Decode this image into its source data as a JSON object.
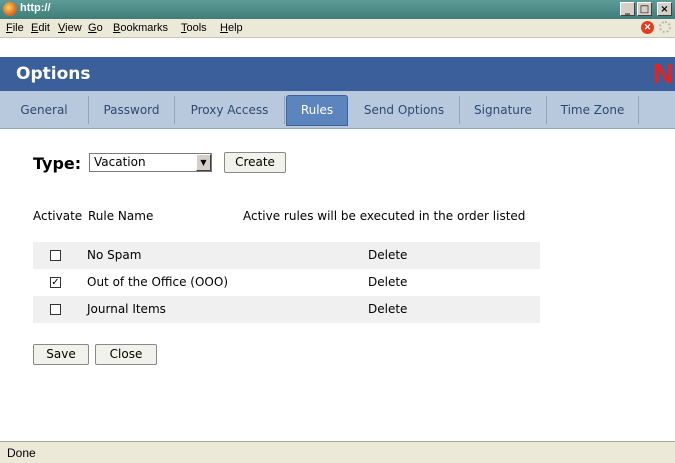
{
  "window": {
    "title": "http://",
    "buttons": {
      "minimize": "_",
      "maximize": "□",
      "close": "×"
    }
  },
  "menu": [
    "File",
    "Edit",
    "View",
    "Go",
    "Bookmarks",
    "Tools",
    "Help"
  ],
  "header": {
    "title": "Options",
    "logo": "N",
    "logo_color": "#e8231d"
  },
  "tabs": [
    {
      "label": "General"
    },
    {
      "label": "Password"
    },
    {
      "label": "Proxy Access"
    },
    {
      "label": "Rules",
      "active": true
    },
    {
      "label": "Send Options"
    },
    {
      "label": "Signature"
    },
    {
      "label": "Time Zone"
    }
  ],
  "type_section": {
    "label": "Type:",
    "selected": "Vacation",
    "create_label": "Create"
  },
  "rules_table": {
    "col_activate": "Activate",
    "col_name": "Rule Name",
    "note": "Active rules will be executed in the order listed",
    "rows": [
      {
        "name": "No Spam",
        "checked": false,
        "delete_label": "Delete"
      },
      {
        "name": "Out of the Office (OOO)",
        "checked": true,
        "delete_label": "Delete"
      },
      {
        "name": "Journal Items",
        "checked": false,
        "delete_label": "Delete"
      }
    ]
  },
  "actions": {
    "save_label": "Save",
    "close_label": "Close"
  },
  "status": {
    "text": "Done"
  },
  "colors": {
    "titlebar": "#4f8d87",
    "header_bg": "#3b5f9b",
    "tab_bg": "#b8c9dd",
    "tab_active": "#5d85bd"
  }
}
